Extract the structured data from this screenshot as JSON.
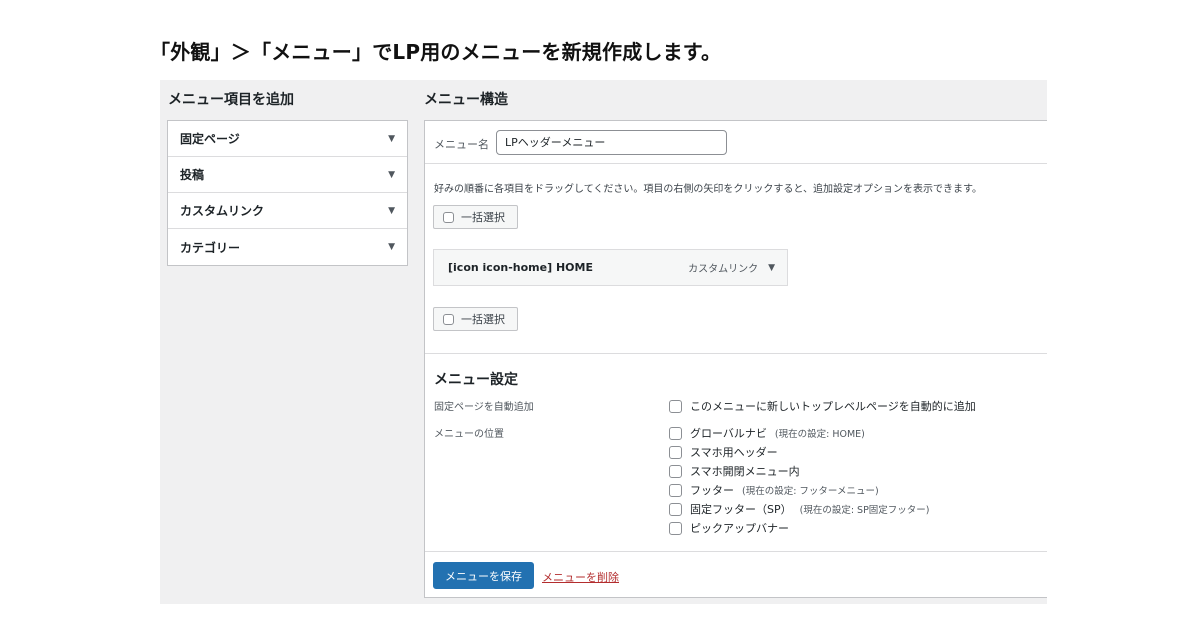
{
  "caption": "「外観」＞「メニュー」でLP用のメニューを新規作成します。",
  "left": {
    "heading": "メニュー項目を追加",
    "items": [
      {
        "label": "固定ページ"
      },
      {
        "label": "投稿"
      },
      {
        "label": "カスタムリンク"
      },
      {
        "label": "カテゴリー"
      }
    ]
  },
  "right": {
    "heading": "メニュー構造",
    "name_label": "メニュー名",
    "name_value": "LPヘッダーメニュー",
    "instructions": "好みの順番に各項目をドラッグしてください。項目の右側の矢印をクリックすると、追加設定オプションを表示できます。",
    "bulk_select": "一括選択",
    "menu_item": {
      "title": "[icon icon-home] HOME",
      "type": "カスタムリンク"
    },
    "settings": {
      "title": "メニュー設定",
      "auto_add_label": "固定ページを自動追加",
      "auto_add_option": "このメニューに新しいトップレベルページを自動的に追加",
      "location_label": "メニューの位置",
      "locations": [
        {
          "label": "グローバルナビ",
          "note": "(現在の設定: HOME)"
        },
        {
          "label": "スマホ用ヘッダー",
          "note": ""
        },
        {
          "label": "スマホ開閉メニュー内",
          "note": ""
        },
        {
          "label": "フッター",
          "note": "(現在の設定: フッターメニュー)"
        },
        {
          "label": "固定フッター（SP）",
          "note": "(現在の設定: SP固定フッター)"
        },
        {
          "label": "ピックアップバナー",
          "note": ""
        }
      ]
    },
    "save_label": "メニューを保存",
    "delete_label": "メニューを削除"
  },
  "colors": {
    "primary": "#2271b1",
    "danger": "#b32d2e",
    "panel_bg": "#f0f0f1"
  },
  "icons": {
    "caret": "triangle-down"
  }
}
